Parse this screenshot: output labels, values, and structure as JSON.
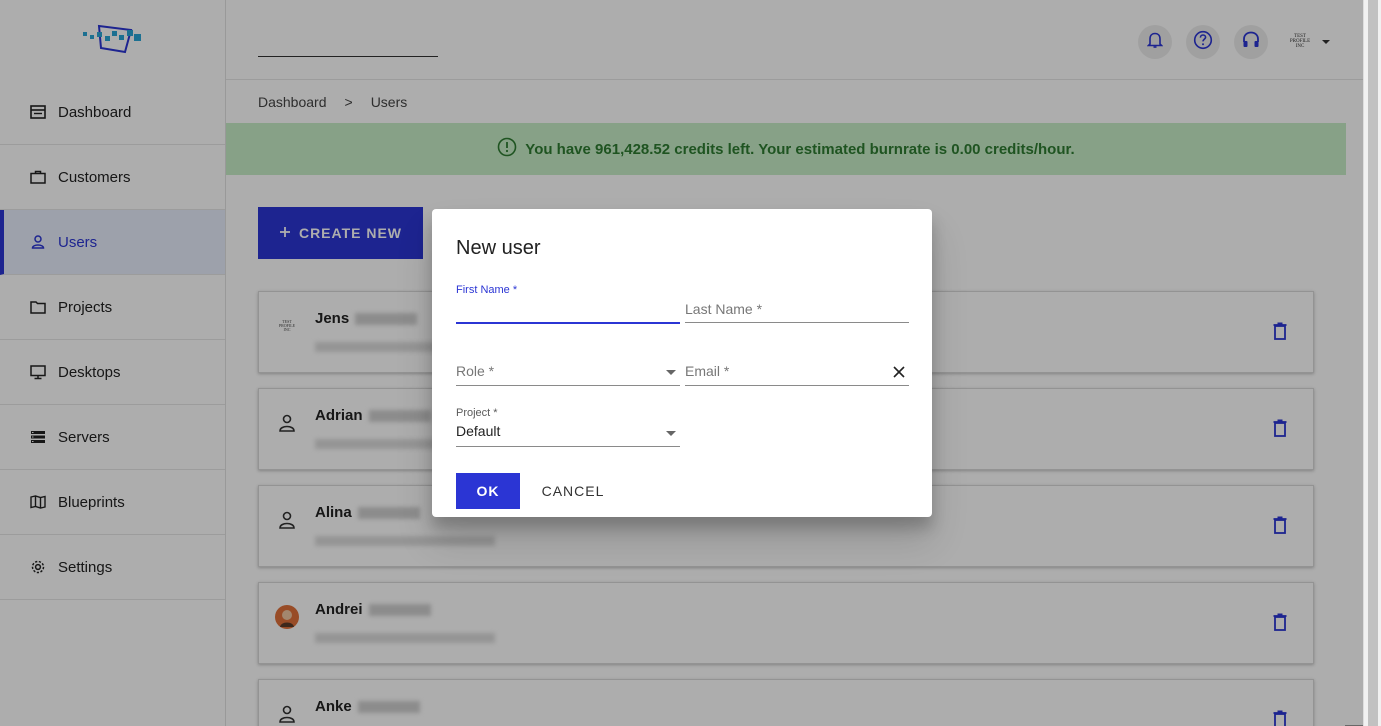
{
  "topbar": {
    "icons": [
      "bell-icon",
      "help-icon",
      "headset-icon"
    ],
    "profile_logo_text": "TEST PROFILE INC"
  },
  "sidebar": {
    "items": [
      {
        "label": "Dashboard",
        "icon": "dashboard-icon"
      },
      {
        "label": "Customers",
        "icon": "briefcase-icon"
      },
      {
        "label": "Users",
        "icon": "user-icon",
        "active": true
      },
      {
        "label": "Projects",
        "icon": "folder-icon"
      },
      {
        "label": "Desktops",
        "icon": "monitor-icon"
      },
      {
        "label": "Servers",
        "icon": "servers-icon"
      },
      {
        "label": "Blueprints",
        "icon": "map-icon"
      },
      {
        "label": "Settings",
        "icon": "gear-icon"
      }
    ]
  },
  "breadcrumb": {
    "root": "Dashboard",
    "separator": ">",
    "current": "Users"
  },
  "banner": {
    "text": "You have 961,428.52 credits left. Your estimated burnrate is 0.00 credits/hour."
  },
  "main": {
    "create_label": "CREATE NEW"
  },
  "users": [
    {
      "first_name": "Jens",
      "avatar": "company-logo"
    },
    {
      "first_name": "Adrian",
      "avatar": "person-icon"
    },
    {
      "first_name": "Alina",
      "avatar": "person-icon"
    },
    {
      "first_name": "Andrei",
      "avatar": "photo"
    },
    {
      "first_name": "Anke",
      "avatar": "person-icon"
    }
  ],
  "dialog": {
    "title": "New user",
    "first_name_label": "First Name *",
    "last_name_placeholder": "Last Name *",
    "role_placeholder": "Role *",
    "email_placeholder": "Email *",
    "project_label": "Project *",
    "project_value": "Default",
    "ok_label": "OK",
    "cancel_label": "CANCEL"
  },
  "colors": {
    "accent": "#2b35d4",
    "banner_bg": "#c8edc8",
    "banner_text": "#2e7d32"
  }
}
